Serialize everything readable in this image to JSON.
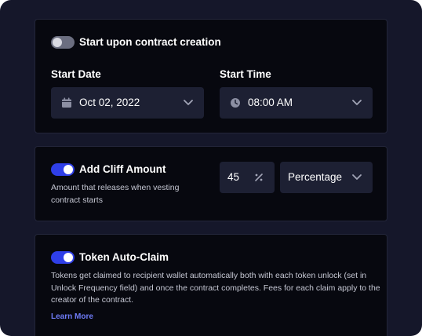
{
  "start_section": {
    "toggle_state": "off",
    "title": "Start upon contract creation",
    "start_date": {
      "label": "Start Date",
      "value": "Oct 02, 2022",
      "icon": "calendar-icon"
    },
    "start_time": {
      "label": "Start Time",
      "value": "08:00 AM",
      "icon": "clock-icon"
    }
  },
  "cliff_section": {
    "toggle_state": "on",
    "title": "Add Cliff Amount",
    "description": "Amount that releases when vesting contract starts",
    "amount": "45",
    "unit_icon": "percent-icon",
    "unit_type": "Percentage"
  },
  "autoclaim_section": {
    "toggle_state": "on",
    "title": "Token Auto-Claim",
    "description": "Tokens get claimed to recipient wallet automatically both with each token unlock (set in Unlock Frequency field) and once the contract completes. Fees for each claim apply to the creator of the contract.",
    "link_label": "Learn More"
  },
  "colors": {
    "background": "#15172a",
    "card": "#07080f",
    "field": "#1d2033",
    "toggle_on": "#2f3fe8",
    "toggle_off": "#6b6e80",
    "link": "#6f7cf7"
  }
}
